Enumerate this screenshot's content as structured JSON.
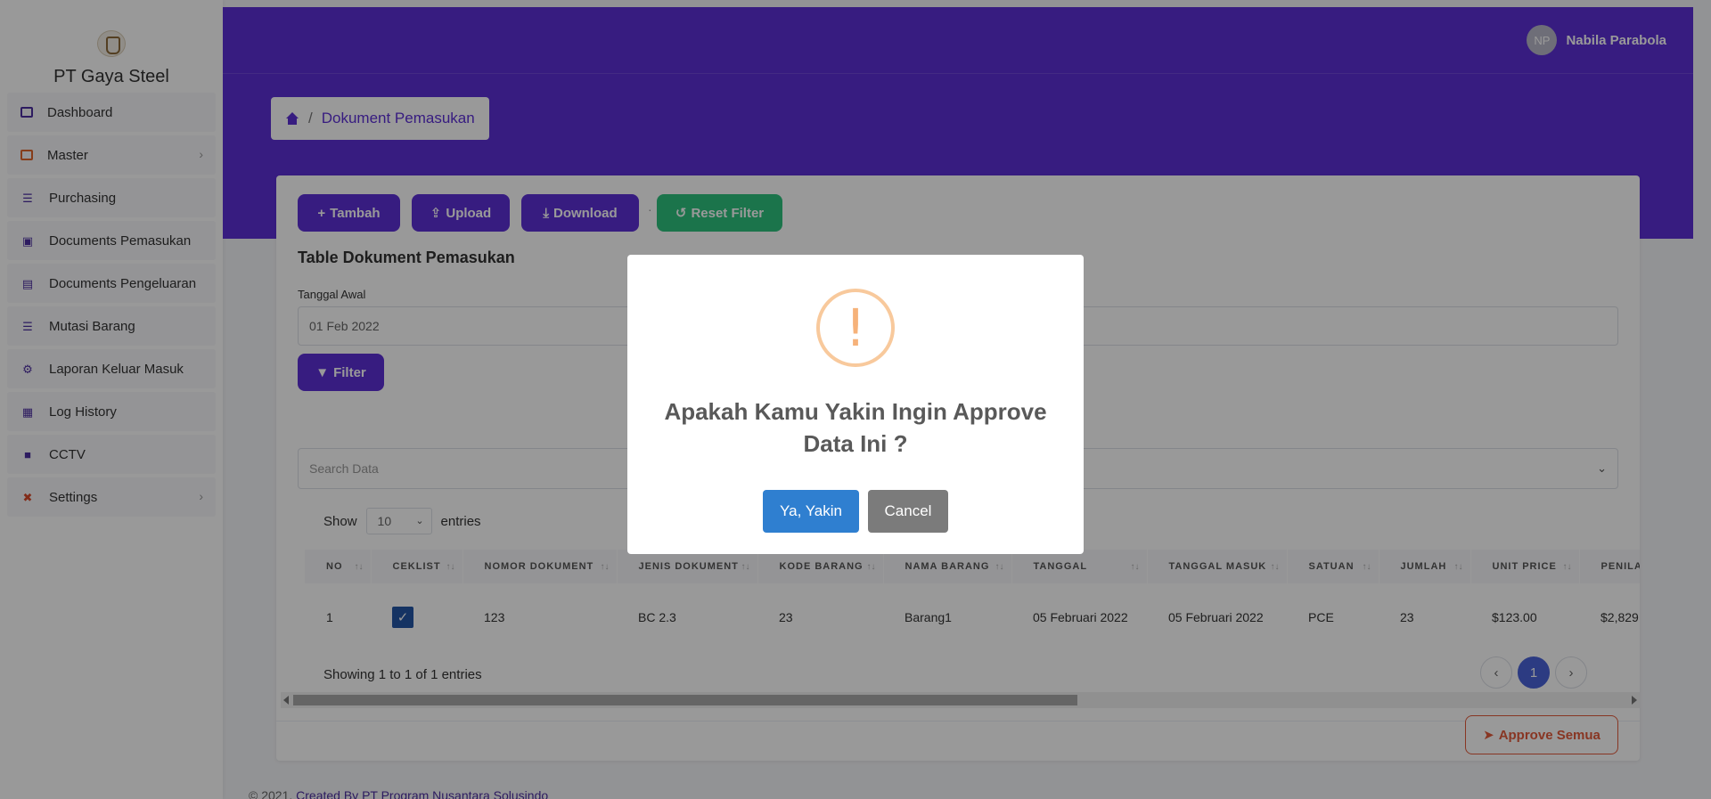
{
  "brand": {
    "name": "PT Gaya Steel"
  },
  "sidebar": {
    "items": [
      {
        "label": "Dashboard",
        "icon": "monitor-icon"
      },
      {
        "label": "Master",
        "icon": "copy-icon",
        "has_submenu": true
      },
      {
        "label": "Purchasing",
        "icon": "stack-icon"
      },
      {
        "label": "Documents Pemasukan",
        "icon": "inbox-icon"
      },
      {
        "label": "Documents Pengeluaran",
        "icon": "id-card-icon"
      },
      {
        "label": "Mutasi Barang",
        "icon": "stack-icon"
      },
      {
        "label": "Laporan Keluar Masuk",
        "icon": "gear-icon"
      },
      {
        "label": "Log History",
        "icon": "archive-icon"
      },
      {
        "label": "CCTV",
        "icon": "camera-icon"
      },
      {
        "label": "Settings",
        "icon": "tools-icon",
        "has_submenu": true
      }
    ]
  },
  "header": {
    "user_initials": "NP",
    "user_name": "Nabila Parabola"
  },
  "breadcrumb": {
    "sep": "/",
    "current": "Dokument Pemasukan"
  },
  "toolbar": {
    "tambah": "Tambah",
    "upload": "Upload",
    "download": "Download",
    "dot": "·",
    "reset": "Reset Filter"
  },
  "card": {
    "title": "Table Dokument Pemasukan",
    "date_label": "Tanggal Awal",
    "date_value": "01 Feb 2022",
    "filter_label": "Filter",
    "search_placeholder": "Search Data"
  },
  "length": {
    "show": "Show",
    "value": "10",
    "entries": "entries"
  },
  "table": {
    "columns": [
      "NO",
      "CEKLIST",
      "NOMOR DOKUMENT",
      "JENIS DOKUMENT",
      "KODE BARANG",
      "NAMA BARANG",
      "TANGGAL",
      "TANGGAL MASUK",
      "SATUAN",
      "JUMLAH",
      "UNIT PRICE",
      "PENILA"
    ],
    "sort_glyph": "↑↓",
    "rows": [
      {
        "no": "1",
        "checked": true,
        "nomor": "123",
        "jenis": "BC 2.3",
        "kode": "23",
        "nama": "Barang1",
        "tanggal": "05 Februari 2022",
        "tanggal_masuk": "05 Februari 2022",
        "satuan": "PCE",
        "jumlah": "23",
        "unit_price": "$123.00",
        "penilaian": "$2,829."
      }
    ]
  },
  "info": "Showing 1 to 1 of 1 entries",
  "pagination": {
    "prev": "‹",
    "current": "1",
    "next": "›"
  },
  "approve_all": "Approve Semua",
  "footer": {
    "copyright": "© 2021,",
    "credit": "Created By PT Program Nusantara Solusindo"
  },
  "modal": {
    "icon_glyph": "!",
    "title": "Apakah Kamu Yakin Ingin Approve Data Ini ?",
    "confirm": "Ya, Yakin",
    "cancel": "Cancel"
  },
  "colors": {
    "primary": "#5d2fd6",
    "success": "#2ec27e",
    "danger": "#e35a3b",
    "confirm": "#2f7fd0",
    "warning": "#f8c99c"
  }
}
